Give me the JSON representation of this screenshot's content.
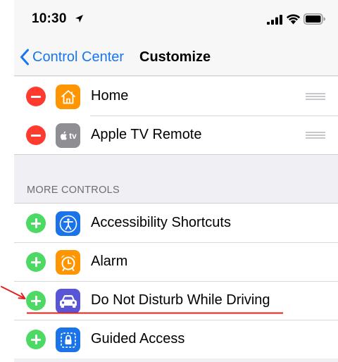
{
  "status_bar": {
    "time": "10:30"
  },
  "nav": {
    "back_label": "Control Center",
    "title": "Customize"
  },
  "included_controls": [
    {
      "label": "Home",
      "icon": "home-icon",
      "icon_color": "#ff9500",
      "action": "remove"
    },
    {
      "label": "Apple TV Remote",
      "icon": "apple-tv-icon",
      "icon_color": "#8e8e93",
      "action": "remove"
    }
  ],
  "more_controls": {
    "header": "MORE CONTROLS",
    "items": [
      {
        "label": "Accessibility Shortcuts",
        "icon": "accessibility-icon",
        "icon_color": "#1a73e8",
        "action": "add"
      },
      {
        "label": "Alarm",
        "icon": "alarm-clock-icon",
        "icon_color": "#ff9500",
        "action": "add"
      },
      {
        "label": "Do Not Disturb While Driving",
        "icon": "car-icon",
        "icon_color": "#5856d6",
        "action": "add"
      },
      {
        "label": "Guided Access",
        "icon": "guided-access-lock-icon",
        "icon_color": "#1a73e8",
        "action": "add"
      }
    ]
  },
  "colors": {
    "accent": "#1677f0",
    "remove": "#ff3b30",
    "add": "#4cd964",
    "annotation": "#e0201f"
  },
  "apple_tv_icon_text": "tv"
}
